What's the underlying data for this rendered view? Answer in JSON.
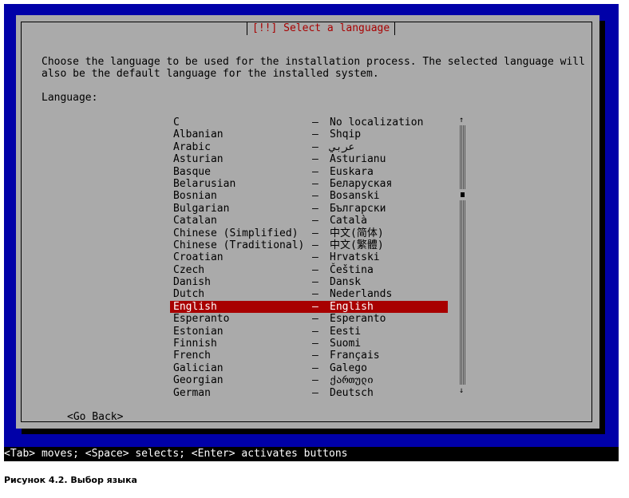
{
  "dialog": {
    "title": "[!!] Select a language",
    "description_line1": "Choose the language to be used for the installation process. The selected language will",
    "description_line2": "also be the default language for the installed system.",
    "language_label": "Language:",
    "go_back_label": "<Go Back>"
  },
  "languages": [
    {
      "name": "C",
      "native": "No localization"
    },
    {
      "name": "Albanian",
      "native": "Shqip"
    },
    {
      "name": "Arabic",
      "native": "عربي"
    },
    {
      "name": "Asturian",
      "native": "Asturianu"
    },
    {
      "name": "Basque",
      "native": "Euskara"
    },
    {
      "name": "Belarusian",
      "native": "Беларуская"
    },
    {
      "name": "Bosnian",
      "native": "Bosanski"
    },
    {
      "name": "Bulgarian",
      "native": "Български"
    },
    {
      "name": "Catalan",
      "native": "Català"
    },
    {
      "name": "Chinese (Simplified)",
      "native": "中文(简体)"
    },
    {
      "name": "Chinese (Traditional)",
      "native": "中文(繁體)"
    },
    {
      "name": "Croatian",
      "native": "Hrvatski"
    },
    {
      "name": "Czech",
      "native": "Čeština"
    },
    {
      "name": "Danish",
      "native": "Dansk"
    },
    {
      "name": "Dutch",
      "native": "Nederlands"
    },
    {
      "name": "English",
      "native": "English"
    },
    {
      "name": "Esperanto",
      "native": "Esperanto"
    },
    {
      "name": "Estonian",
      "native": "Eesti"
    },
    {
      "name": "Finnish",
      "native": "Suomi"
    },
    {
      "name": "French",
      "native": "Français"
    },
    {
      "name": "Galician",
      "native": "Galego"
    },
    {
      "name": "Georgian",
      "native": "ქართული"
    },
    {
      "name": "German",
      "native": "Deutsch"
    }
  ],
  "selected_language": "English",
  "separator": "–",
  "scrollbar": {
    "up_arrow": "↑",
    "down_arrow": "↓"
  },
  "statusbar": {
    "text": "<Tab> moves; <Space> selects; <Enter> activates buttons"
  },
  "caption": "Рисунок 4.2. Выбор языка",
  "colors": {
    "screen_bg": "#0000a8",
    "dialog_bg": "#aaaaaa",
    "title_color": "#a80000",
    "selection_bg": "#a80000",
    "selection_fg": "#ffffff"
  }
}
